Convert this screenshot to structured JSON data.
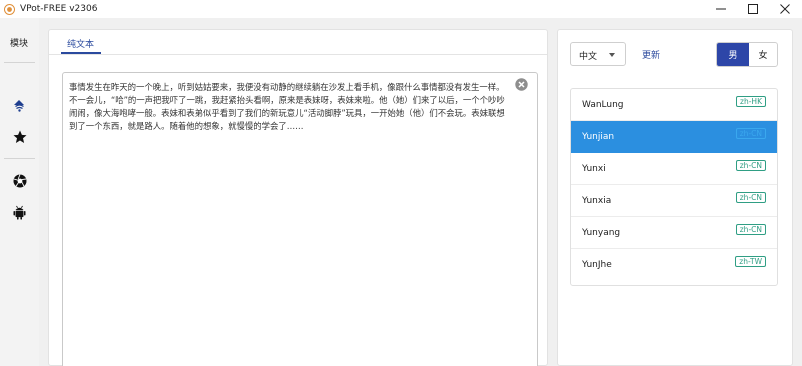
{
  "window": {
    "title": "VPot-FREE v2306",
    "icon": "app-logo-icon",
    "controls": [
      "minimize-icon",
      "maximize-icon",
      "close-icon"
    ]
  },
  "sidebar": {
    "label": "模块",
    "items": [
      {
        "name": "speech-icon",
        "active": true
      },
      {
        "name": "star-icon",
        "active": false
      },
      {
        "name": "aperture-icon",
        "active": false
      },
      {
        "name": "android-icon",
        "active": false
      }
    ]
  },
  "main": {
    "tab_label": "纯文本",
    "text": "事情发生在昨天的一个晚上，听到姑姑要来，我便没有动静的继续躺在沙发上看手机，像跟什么事情都没有发生一样。不一会儿，“哈”的一声把我吓了一跳，我赶紧抬头看啊，原来是表妹呀，表妹来啦。他（她）们来了以后，一个个吵吵闹闹，像大海咆哮一般。表妹和表弟似乎看到了我们的新玩意儿“活动脚脖”玩具，一开始她（他）们不会玩。表妹联想到了一个东西，就是路人。随着他的想象，就慢慢的学会了……",
    "clear_icon": "clear-icon"
  },
  "voice_panel": {
    "language": "中文",
    "refresh_label": "更新",
    "gender_male": "男",
    "gender_female": "女",
    "selected_gender": "男",
    "voices": [
      {
        "name": "WanLung",
        "locale": "zh-HK",
        "selected": false
      },
      {
        "name": "Yunjian",
        "locale": "zh-CN",
        "selected": true
      },
      {
        "name": "Yunxi",
        "locale": "zh-CN",
        "selected": false
      },
      {
        "name": "Yunxia",
        "locale": "zh-CN",
        "selected": false
      },
      {
        "name": "Yunyang",
        "locale": "zh-CN",
        "selected": false
      },
      {
        "name": "YunJhe",
        "locale": "zh-TW",
        "selected": false
      }
    ]
  },
  "colors": {
    "accent": "#2b4a9e",
    "selected_row": "#2b8fe0",
    "gender_active": "#2d46a8",
    "tag": "#2f9e84"
  }
}
